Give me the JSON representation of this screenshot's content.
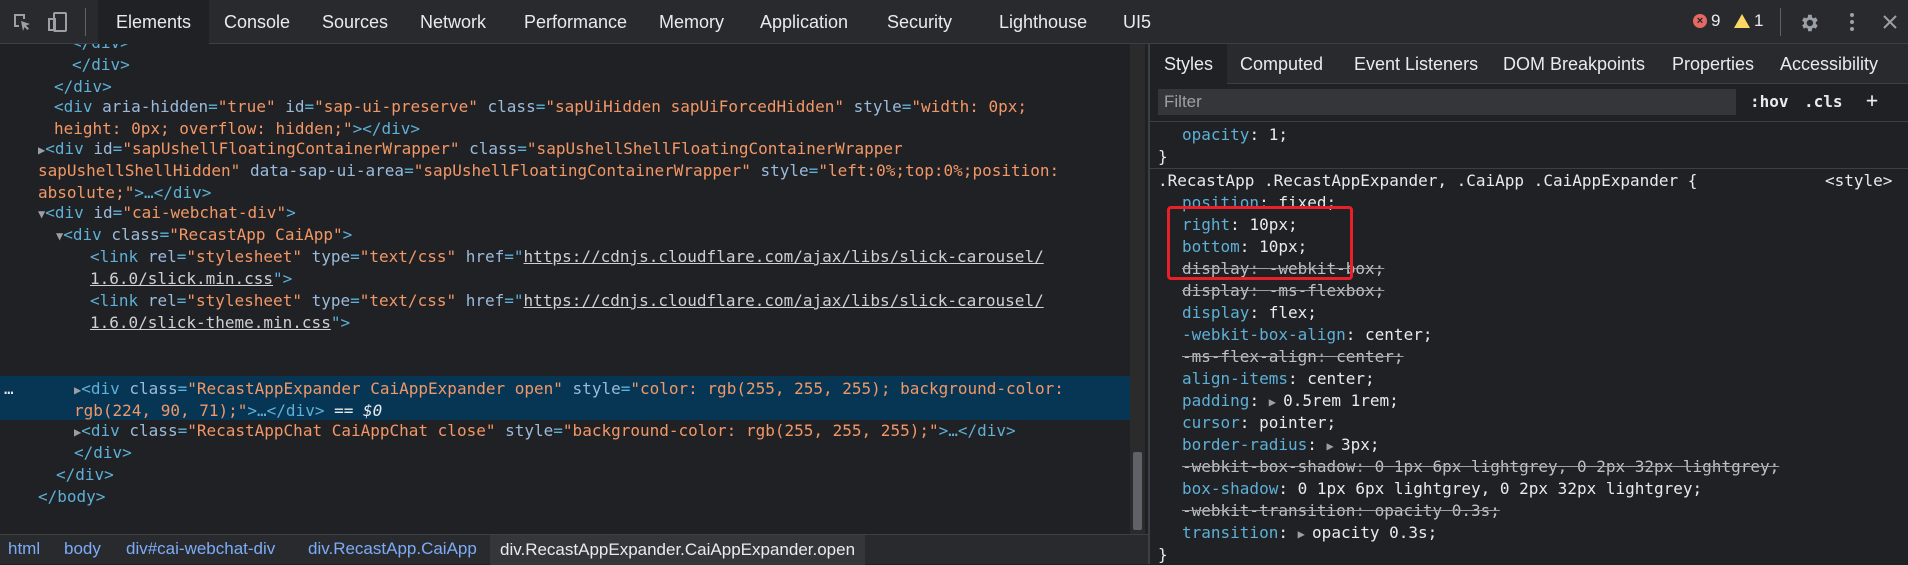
{
  "toolbar": {
    "tabs": [
      "Elements",
      "Console",
      "Sources",
      "Network",
      "Performance",
      "Memory",
      "Application",
      "Security",
      "Lighthouse",
      "UI5"
    ],
    "errors": "9",
    "warnings": "1"
  },
  "dom": {
    "lines": [
      "</div>",
      "</div>",
      "</div>"
    ],
    "preserve_div": {
      "tag_open": "<div",
      "a1": "aria-hidden",
      "v1": "\"true\"",
      "a2": "id",
      "v2": "\"sap-ui-preserve\"",
      "a3": "class",
      "v3": "\"sapUiHidden sapUiForcedHidden\"",
      "a4": "style",
      "v4a": "\"width: 0px;",
      "v4b": "height: 0px; overflow: hidden;\"",
      "close": "></div>"
    },
    "floating_div": {
      "a1": "id",
      "v1": "\"sapUshellFloatingContainerWrapper\"",
      "a2": "class",
      "v2a": "\"sapUshellShellFloatingContainerWrapper",
      "v2b": "sapUshellShellHidden\"",
      "a3": "data-sap-ui-area",
      "v3": "\"sapUshellFloatingContainerWrapper\"",
      "a4": "style",
      "v4a": "\"left:0%;top:0%;position:",
      "v4b": "absolute;\"",
      "close": ">…</div>"
    },
    "webchat_div": {
      "a1": "id",
      "v1": "\"cai-webchat-div\""
    },
    "recast_div": {
      "a1": "class",
      "v1": "\"RecastApp CaiApp\""
    },
    "link1": {
      "a1": "rel",
      "v1": "\"stylesheet\"",
      "a2": "type",
      "v2": "\"text/css\"",
      "a3": "href",
      "href_a": "https://cdnjs.cloudflare.com/ajax/libs/slick-carousel/",
      "href_b": "1.6.0/slick.min.css"
    },
    "link2": {
      "a1": "rel",
      "v1": "\"stylesheet\"",
      "a2": "type",
      "v2": "\"text/css\"",
      "a3": "href",
      "href_a": "https://cdnjs.cloudflare.com/ajax/libs/slick-carousel/",
      "href_b": "1.6.0/slick-theme.min.css"
    },
    "expander_div": {
      "a1": "class",
      "v1": "\"RecastAppExpander CaiAppExpander open\"",
      "a2": "style",
      "v2a": "\"color: rgb(255, 255, 255); background-color:",
      "v2b": "rgb(224, 90, 71);\"",
      "close": ">…</div>",
      "marker": "== $0",
      "dots": "…"
    },
    "chat_div": {
      "a1": "class",
      "v1": "\"RecastAppChat CaiAppChat close\"",
      "a2": "style",
      "v2": "\"background-color: rgb(255, 255, 255);\"",
      "close": ">…</div>"
    },
    "end_div": "</div>",
    "end_div2": "</div>",
    "end_body": "</body>"
  },
  "breadcrumbs": [
    "html",
    "body",
    "div#cai-webchat-div",
    "div.RecastApp.CaiApp",
    "div.RecastAppExpander.CaiAppExpander.open"
  ],
  "sidebar": {
    "tabs": [
      "Styles",
      "Computed",
      "Event Listeners",
      "DOM Breakpoints",
      "Properties",
      "Accessibility"
    ],
    "filter_placeholder": "Filter",
    "hov": ":hov",
    "cls": ".cls",
    "plus": "+"
  },
  "styles": {
    "prev_rule_prop": "opacity",
    "prev_rule_val": "1;",
    "prev_close": "}",
    "selector": ".RecastApp .RecastAppExpander, .CaiApp .CaiAppExpander {",
    "source": "<style>",
    "props": [
      {
        "name": "position",
        "value": "fixed;",
        "struck": false
      },
      {
        "name": "right",
        "value": "10px;",
        "struck": false
      },
      {
        "name": "bottom",
        "value": "10px;",
        "struck": false
      },
      {
        "name": "display",
        "value": "-webkit-box;",
        "struck": true
      },
      {
        "name": "display",
        "value": "-ms-flexbox;",
        "struck": true
      },
      {
        "name": "display",
        "value": "flex;",
        "struck": false
      },
      {
        "name": "-webkit-box-align",
        "value": "center;",
        "struck": false
      },
      {
        "name": "-ms-flex-align",
        "value": "center;",
        "struck": true
      },
      {
        "name": "align-items",
        "value": "center;",
        "struck": false
      },
      {
        "name": "padding",
        "value": "0.5rem 1rem;",
        "struck": false
      },
      {
        "name": "cursor",
        "value": "pointer;",
        "struck": false
      },
      {
        "name": "border-radius",
        "value": "3px;",
        "struck": false
      },
      {
        "name": "-webkit-box-shadow",
        "value": "0 1px 6px lightgrey, 0 2px 32px lightgrey;",
        "struck": true
      },
      {
        "name": "box-shadow",
        "value": "0 1px 6px lightgrey, 0 2px 32px lightgrey;",
        "struck": false
      },
      {
        "name": "-webkit-transition",
        "value": "opacity 0.3s;",
        "struck": true
      },
      {
        "name": "transition",
        "value": "opacity 0.3s;",
        "struck": false
      }
    ],
    "close": "}"
  }
}
